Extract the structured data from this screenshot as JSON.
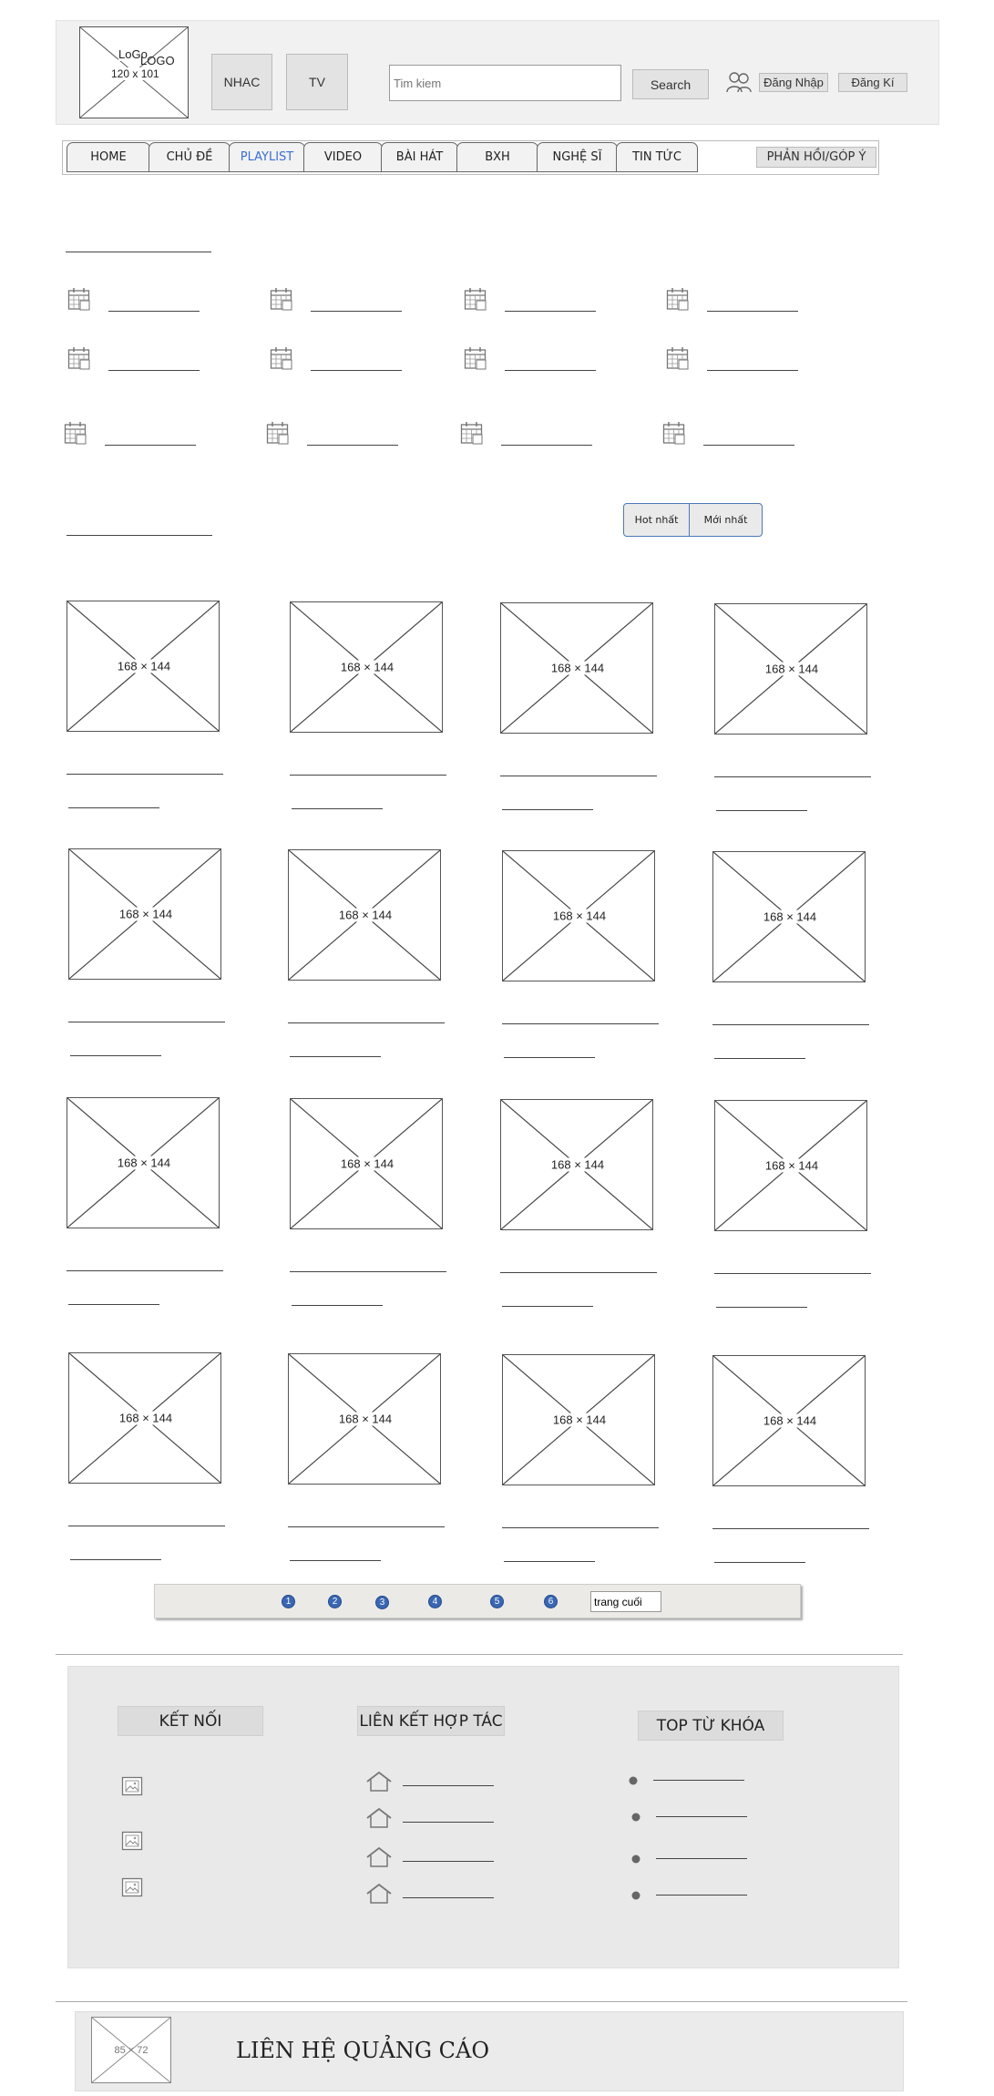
{
  "header": {
    "logo_text_top": "LoGo",
    "logo_text_over": "LOGO",
    "logo_dims": "120 x 101",
    "nhac_label": "NHAC",
    "tv_label": "TV",
    "search_placeholder": "Tim kiem",
    "search_label": "Search",
    "login_label": "Đăng Nhập",
    "register_label": "Đăng Kí"
  },
  "nav": {
    "tabs": [
      "HOME",
      "CHỦ ĐỀ",
      "PLAYLIST",
      "VIDEO",
      "BÀI HÁT",
      "BXH",
      "NGHỆ SĨ",
      "TIN TỨC"
    ],
    "active_tab": "PLAYLIST",
    "feedback_label": "PHẢN HỒI/GÓP Ý",
    "active_color": "#3a6fd8"
  },
  "sort": {
    "hot_label": "Hot nhất",
    "new_label": "Mới nhất"
  },
  "grid": {
    "thumb_label": "168 × 144",
    "count": 16
  },
  "pagination": {
    "pages": [
      "1",
      "2",
      "3",
      "4",
      "5",
      "6"
    ],
    "last_label": "trang cuối"
  },
  "footer": {
    "connect_title": "KẾT NỐI",
    "partner_title": "LIÊN KẾT HỢP TÁC",
    "keywords_title": "TOP TỪ KHÓA"
  },
  "ad": {
    "img_label": "85 × 72",
    "text": "LIÊN HỆ QUẢNG CÁO"
  }
}
